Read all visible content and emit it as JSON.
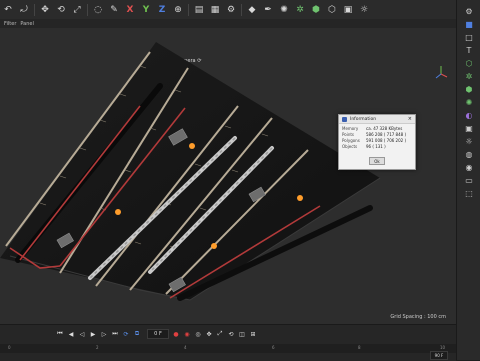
{
  "toolbar": {
    "icons": [
      "undo-icon",
      "redo-icon",
      "select-icon",
      "move-icon",
      "rotate-icon",
      "scale-icon",
      "live-select-icon",
      "brush-icon",
      "x-axis-lock",
      "y-axis-lock",
      "z-axis-lock",
      "coordinate-system-icon",
      "render-region-icon",
      "render-view-icon",
      "render-settings-icon",
      "edit-render-icon",
      "cube-icon",
      "pen-icon",
      "subdivision-icon",
      "cloner-icon",
      "deformer-icon",
      "floor-icon",
      "camera-icon",
      "light-icon"
    ],
    "x_label": "X",
    "y_label": "Y",
    "z_label": "Z",
    "x_color": "#e05050",
    "y_color": "#70c050",
    "z_color": "#4f7fe0"
  },
  "menu": {
    "items": [
      "Filter",
      "Panel"
    ]
  },
  "viewport": {
    "camera_label": "Camera ⟳",
    "grid_label": "Grid Spacing : 100 cm"
  },
  "dialog": {
    "title": "Information",
    "rows": [
      {
        "key": "Memory",
        "value": "ca. 47 328 KBytes"
      },
      {
        "key": "Points",
        "value": "586 208 ( 717 848 )"
      },
      {
        "key": "Polygons",
        "value": "591 008 ( 706 202 )"
      },
      {
        "key": "Objects",
        "value": "96 ( 131 )"
      }
    ],
    "ok_label": "Ok"
  },
  "timeline": {
    "frame_value": "0 F",
    "ruler_ticks": [
      "0",
      "2",
      "4",
      "6",
      "8",
      "10"
    ],
    "end_frame": "90 F"
  },
  "rightbar": {
    "icons": [
      "gear-icon",
      "cube-icon",
      "spline-icon",
      "text-icon",
      "nurbs-icon",
      "array-icon",
      "atom-icon",
      "bend-icon",
      "tag-icon",
      "camera-icon",
      "light-icon",
      "sky-icon",
      "environment-icon",
      "floor-icon",
      "scene-icon"
    ]
  }
}
